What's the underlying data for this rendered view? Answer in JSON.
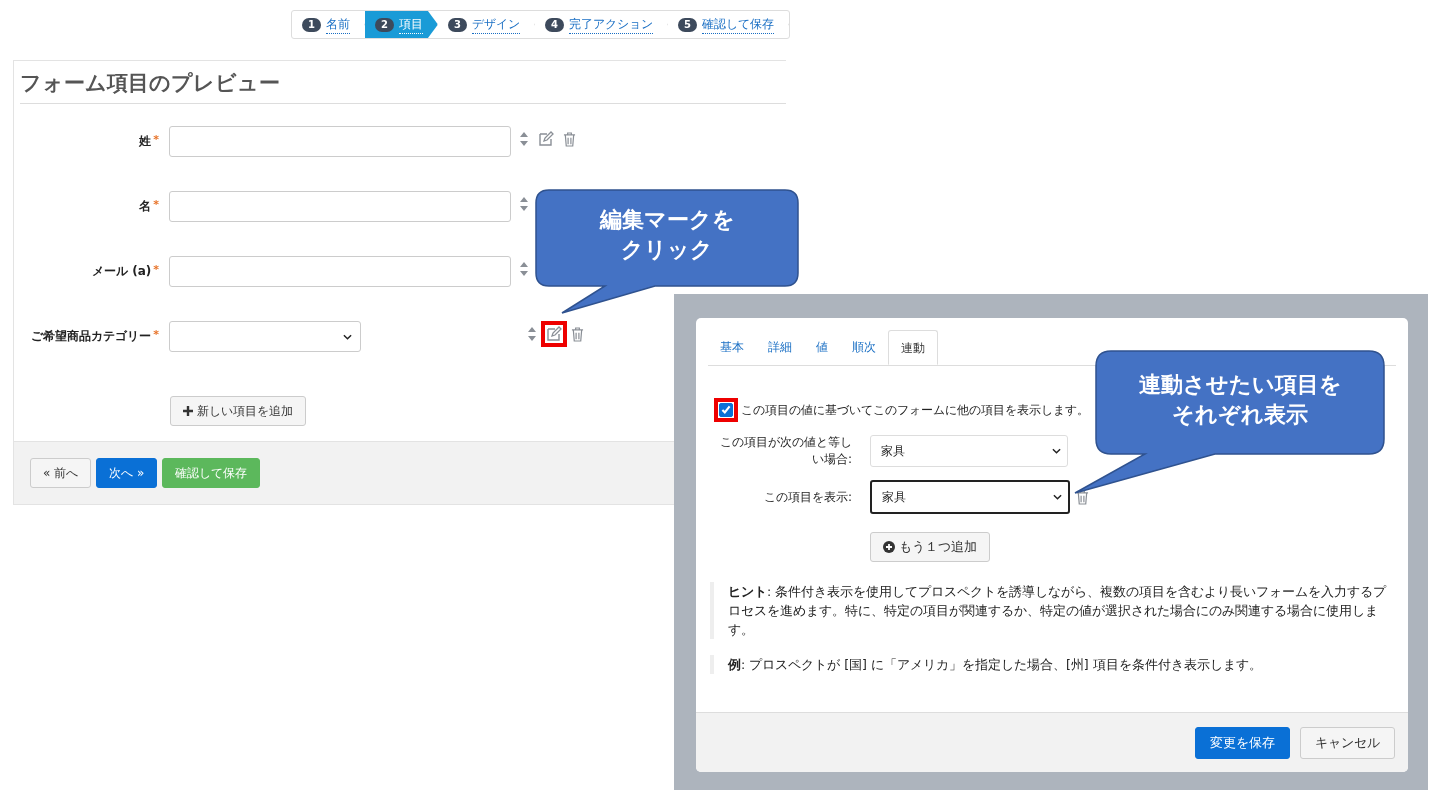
{
  "steps": [
    {
      "number": "1",
      "label": "名前",
      "selected": false
    },
    {
      "number": "2",
      "label": "項目",
      "selected": true
    },
    {
      "number": "3",
      "label": "デザイン",
      "selected": false
    },
    {
      "number": "4",
      "label": "完了アクション",
      "selected": false
    },
    {
      "number": "5",
      "label": "確認して保存",
      "selected": false
    }
  ],
  "preview": {
    "title": "フォーム項目のプレビュー",
    "required_mark": "*",
    "fields": [
      {
        "label": "姓",
        "kind": "text",
        "required": true,
        "edit_highlighted": false
      },
      {
        "label": "名",
        "kind": "text",
        "required": true
      },
      {
        "label": "メール (a)",
        "kind": "text",
        "required": true
      },
      {
        "label": "ご希望商品カテゴリー",
        "kind": "select",
        "required": true,
        "edit_highlighted": true
      }
    ],
    "add_button": "新しい項目を追加",
    "footer_buttons": [
      {
        "label": "« 前へ",
        "kind": "default"
      },
      {
        "label": "次へ »",
        "kind": "primary"
      },
      {
        "label": "確認して保存",
        "kind": "success"
      }
    ]
  },
  "dialog": {
    "tabs": [
      {
        "label": "基本",
        "selected": false
      },
      {
        "label": "詳細",
        "selected": false
      },
      {
        "label": "値",
        "selected": false
      },
      {
        "label": "順次",
        "selected": false
      },
      {
        "label": "連動",
        "selected": true
      }
    ],
    "checkbox": {
      "label": "この項目の値に基づいてこのフォームに他の項目を表示します。",
      "checked": true,
      "highlighted": true
    },
    "conditions": [
      {
        "label": "この項目が次の値と等しい場合:",
        "value": "家具",
        "focused": false,
        "deletable": false
      },
      {
        "label": "この項目を表示:",
        "value": "家具",
        "focused": true,
        "deletable": true
      }
    ],
    "add_button": "もう１つ追加",
    "notes": [
      "**ヒント**: 条件付き表示を使用してプロスペクトを誘導しながら、複数の項目を含むより長いフォームを入力するプロセスを進めます。特に、特定の項目が関連するか、特定の値が選択された場合にのみ関連する場合に使用します。",
      "**例**: プロスペクトが [国] に「アメリカ」を指定した場合、[州] 項目を条件付き表示します。"
    ],
    "footer_buttons": [
      {
        "label": "変更を保存",
        "kind": "primary"
      },
      {
        "label": "キャンセル",
        "kind": "default"
      }
    ]
  },
  "callouts": [
    {
      "lines": [
        "編集マークを",
        "クリック"
      ],
      "kind": "edit"
    },
    {
      "lines": [
        "連動させたい項目を",
        "それぞれ表示"
      ],
      "kind": "linked"
    }
  ]
}
